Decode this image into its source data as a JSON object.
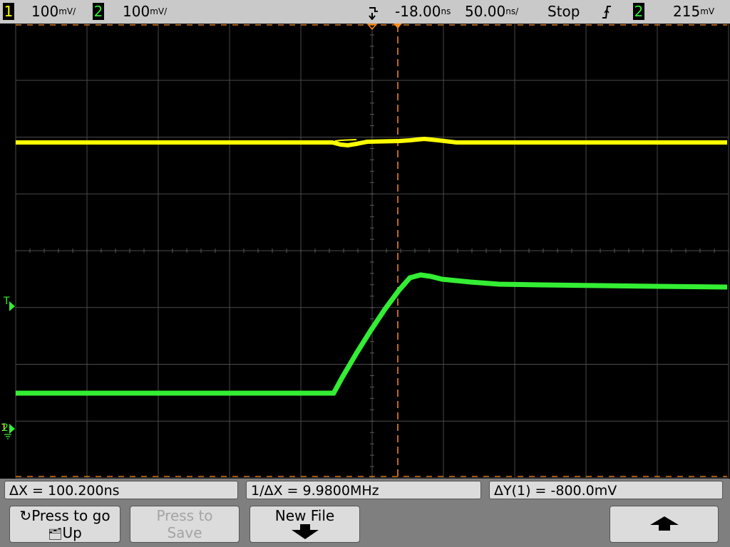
{
  "topbar": {
    "ch1_num": "1",
    "ch1_scale": "100",
    "ch1_unit": "mV/",
    "ch2_num": "2",
    "ch2_scale": "100",
    "ch2_unit": "mV/",
    "time_delay": "-18.00",
    "time_delay_unit": "ns",
    "time_scale": "50.00",
    "time_scale_unit": "ns/",
    "run_state": "Stop",
    "trigger_slope": "rising-edge-icon",
    "trigger_source": "2",
    "trigger_level": "215",
    "trigger_level_unit": "mV"
  },
  "markers": {
    "trigger_level_marker": "T",
    "ground_marker": "2",
    "ground_marker_back": "1"
  },
  "traces": {
    "ch1_color": "#ffff00",
    "ch2_color": "#33ee33",
    "cursor_color": "#ff8c1a"
  },
  "measurements": {
    "delta_x": "ΔX = 100.200ns",
    "inv_delta_x": "1/ΔX = 9.9800MHz",
    "delta_y": "ΔY(1) = -800.0mV"
  },
  "softkeys": {
    "press_to_go_line1": "Press to go",
    "press_to_go_line2": "Up",
    "press_to_save_line1": "Press to",
    "press_to_save_line2": "Save",
    "new_file": "New File",
    "up_arrow_icon": "up-arrow-icon"
  }
}
